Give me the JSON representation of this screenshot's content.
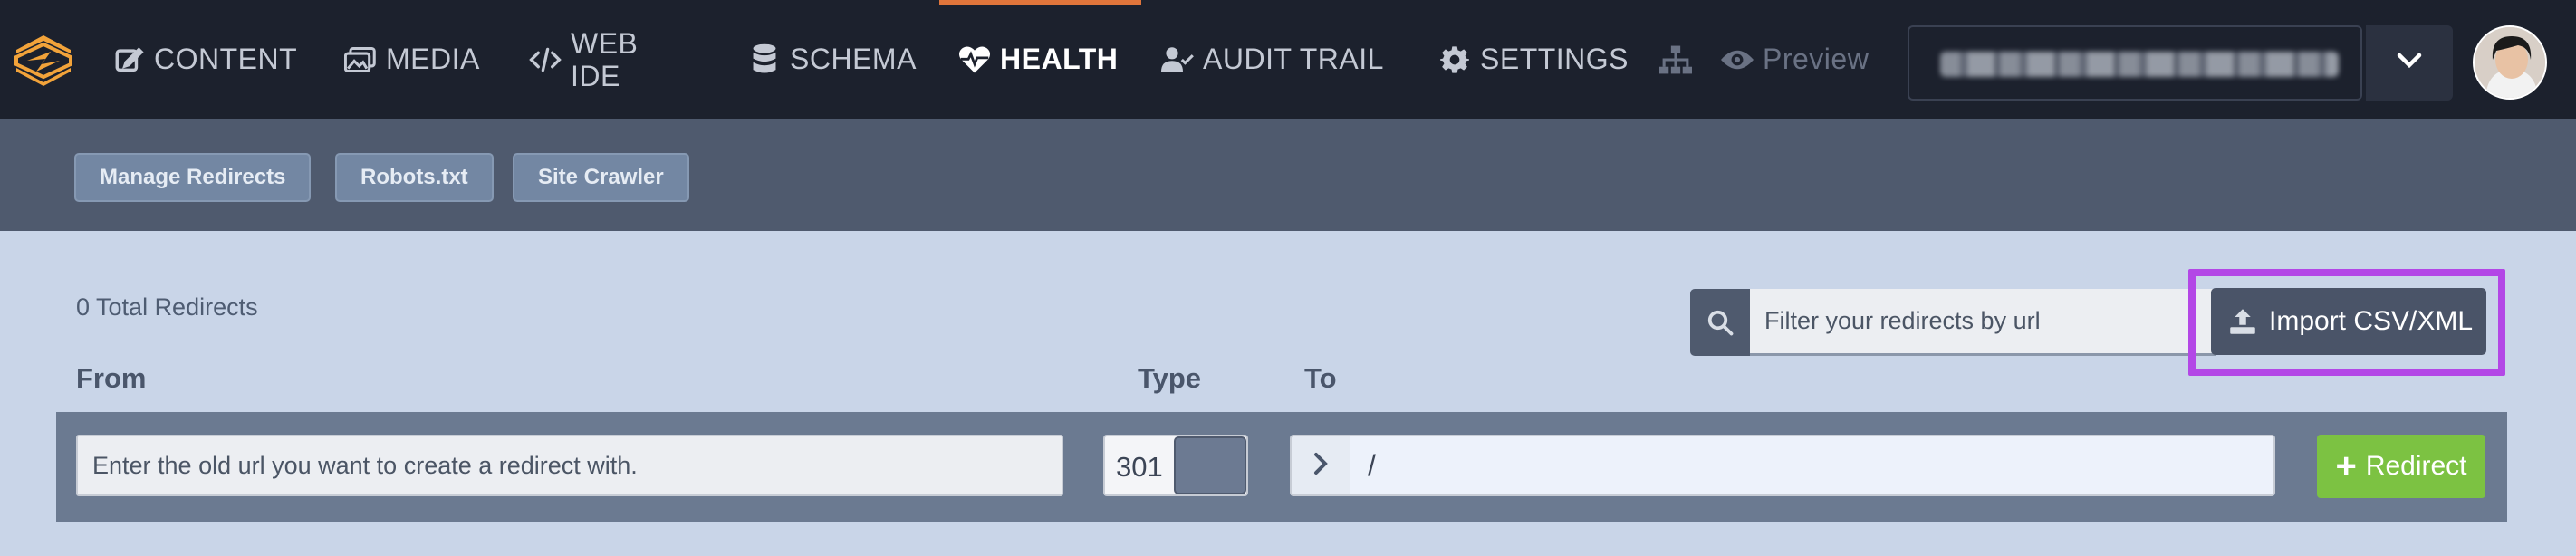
{
  "nav": {
    "items": [
      {
        "label": "CONTENT",
        "icon": "edit-icon"
      },
      {
        "label": "MEDIA",
        "icon": "images-icon"
      },
      {
        "label": "WEB IDE",
        "icon": "code-icon"
      },
      {
        "label": "SCHEMA",
        "icon": "database-icon"
      },
      {
        "label": "HEALTH",
        "icon": "heartbeat-icon",
        "active": true
      },
      {
        "label": "AUDIT TRAIL",
        "icon": "user-check-icon"
      },
      {
        "label": "SETTINGS",
        "icon": "gear-icon"
      }
    ],
    "web_ide_line1": "WEB",
    "web_ide_line2": "IDE",
    "preview_label": "Preview",
    "accent_color": "#e0753b"
  },
  "subnav": {
    "buttons": [
      "Manage Redirects",
      "Robots.txt",
      "Site Crawler"
    ]
  },
  "redirects": {
    "total_text": "0 Total Redirects",
    "filter_placeholder": "Filter your redirects by url",
    "import_label": "Import CSV/XML",
    "highlight_color": "#b347e6",
    "columns": {
      "from": "From",
      "type": "Type",
      "to": "To"
    },
    "from_placeholder": "Enter the old url you want to create a redirect with.",
    "type_value": "301",
    "to_value": "/",
    "add_label": "Redirect",
    "add_color": "#7cc242"
  }
}
